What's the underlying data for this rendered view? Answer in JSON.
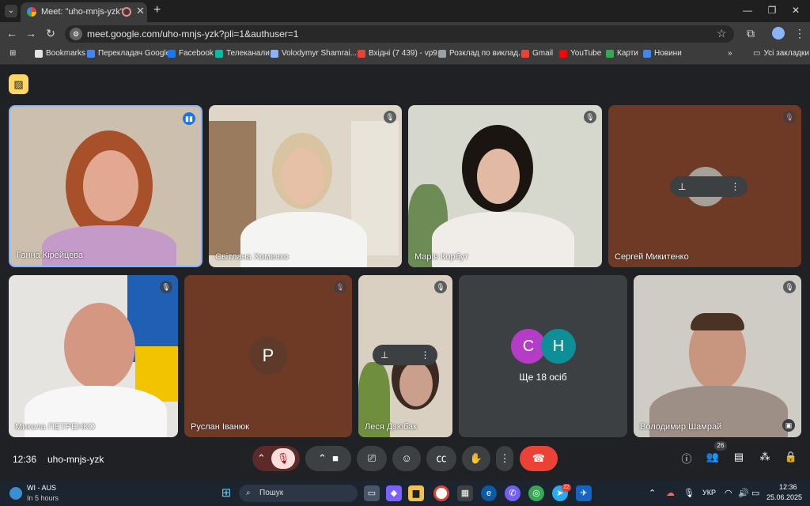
{
  "browser": {
    "tab_title": "Meet: \"uho-mnjs-yzk\"",
    "url": "meet.google.com/uho-mnjs-yzk?pli=1&authuser=1",
    "bookmarks": [
      {
        "label": "Bookmarks",
        "icon": "star-icon",
        "color": "#e3e3e3"
      },
      {
        "label": "Перекладач Google",
        "icon": "translate-icon",
        "color": "#4285f4"
      },
      {
        "label": "Facebook",
        "icon": "facebook-icon",
        "color": "#1877f2"
      },
      {
        "label": "Телеканали",
        "icon": "tv-icon",
        "color": "#00bfa5"
      },
      {
        "label": "Volodymyr Shamrai...",
        "icon": "wave-icon",
        "color": "#8ab4f8"
      },
      {
        "label": "Вхідні (7 439) - vp9...",
        "icon": "gmail-icon",
        "color": "#ea4335"
      },
      {
        "label": "Розклад по виклад...",
        "icon": "globe-icon",
        "color": "#9aa0a6"
      },
      {
        "label": "Gmail",
        "icon": "gmail-icon",
        "color": "#ea4335"
      },
      {
        "label": "YouTube",
        "icon": "youtube-icon",
        "color": "#ff0000"
      },
      {
        "label": "Карти",
        "icon": "maps-icon",
        "color": "#34a853"
      },
      {
        "label": "Новини",
        "icon": "news-icon",
        "color": "#4285f4"
      }
    ],
    "all_bookmarks": "Усі закладки"
  },
  "meet": {
    "tiles": [
      {
        "name": "Ганна Кірейцева",
        "mic": "speaking"
      },
      {
        "name": "Світлана Хоменко",
        "mic": "muted"
      },
      {
        "name": "Марія Корбут",
        "mic": "muted"
      },
      {
        "name": "Сергей Микитенко",
        "mic": "muted-red"
      },
      {
        "name": "Микола ПЕТРЕНКО",
        "mic": "muted"
      },
      {
        "name": "Руслан Іванюк",
        "mic": "muted-red",
        "initial": "P"
      },
      {
        "name": "Леся Дзюбак",
        "mic": "muted"
      },
      {
        "name": "Володимир Шамрай",
        "mic": "muted"
      }
    ],
    "others": {
      "label": "Ще 18 осіб",
      "initials": [
        "C",
        "H"
      ],
      "colors": [
        "#b43cc7",
        "#0e8f97"
      ]
    },
    "clock": "12:36",
    "meeting_code": "uho-mnjs-yzk",
    "participants_count": "26"
  },
  "taskbar": {
    "weather_title": "WI - AUS",
    "weather_sub": "In 5 hours",
    "search": "Пошук",
    "lang": "УКР",
    "time": "12:36",
    "date": "25.06.2025",
    "telegram_badge": "22"
  }
}
